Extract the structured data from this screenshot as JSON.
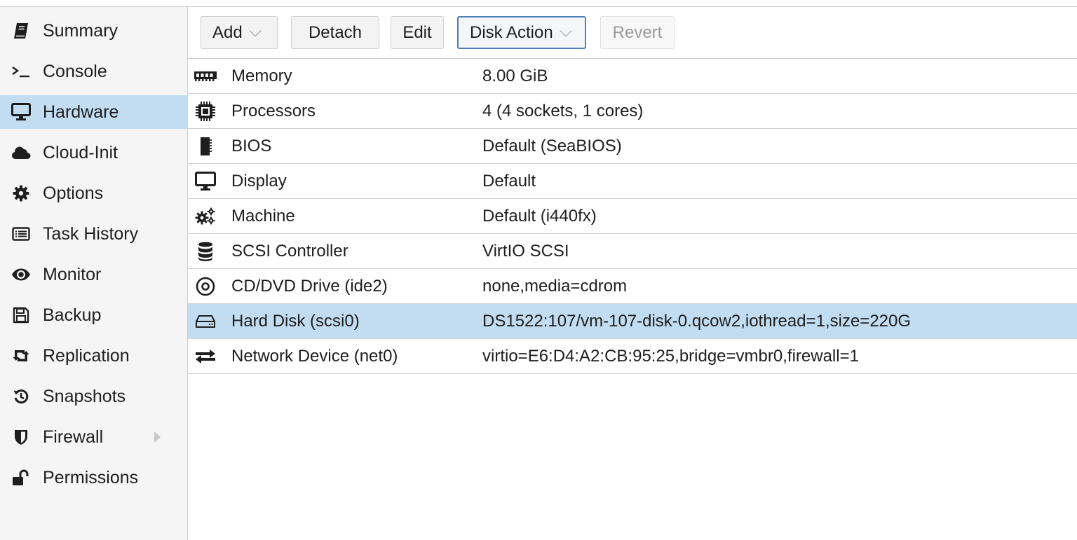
{
  "sidebar": {
    "items": [
      {
        "label": "Summary",
        "icon": "book-icon"
      },
      {
        "label": "Console",
        "icon": "terminal-icon"
      },
      {
        "label": "Hardware",
        "icon": "desktop-icon",
        "active": true
      },
      {
        "label": "Cloud-Init",
        "icon": "cloud-icon"
      },
      {
        "label": "Options",
        "icon": "gear-icon"
      },
      {
        "label": "Task History",
        "icon": "list-icon"
      },
      {
        "label": "Monitor",
        "icon": "eye-icon"
      },
      {
        "label": "Backup",
        "icon": "floppy-icon"
      },
      {
        "label": "Replication",
        "icon": "retweet-icon"
      },
      {
        "label": "Snapshots",
        "icon": "history-icon"
      },
      {
        "label": "Firewall",
        "icon": "shield-icon",
        "expandable": true
      },
      {
        "label": "Permissions",
        "icon": "unlock-icon"
      }
    ]
  },
  "toolbar": {
    "add_label": "Add",
    "detach_label": "Detach",
    "edit_label": "Edit",
    "disk_action_label": "Disk Action",
    "revert_label": "Revert"
  },
  "hardware": {
    "rows": [
      {
        "name": "Memory",
        "value": "8.00 GiB",
        "icon": "memory-icon"
      },
      {
        "name": "Processors",
        "value": "4 (4 sockets, 1 cores)",
        "icon": "cpu-icon"
      },
      {
        "name": "BIOS",
        "value": "Default (SeaBIOS)",
        "icon": "bios-chip-icon"
      },
      {
        "name": "Display",
        "value": "Default",
        "icon": "display-icon"
      },
      {
        "name": "Machine",
        "value": "Default (i440fx)",
        "icon": "cogs-icon"
      },
      {
        "name": "SCSI Controller",
        "value": "VirtIO SCSI",
        "icon": "database-icon"
      },
      {
        "name": "CD/DVD Drive (ide2)",
        "value": "none,media=cdrom",
        "icon": "cdrom-icon"
      },
      {
        "name": "Hard Disk (scsi0)",
        "value": "DS1522:107/vm-107-disk-0.qcow2,iothread=1,size=220G",
        "icon": "hdd-icon",
        "selected": true
      },
      {
        "name": "Network Device (net0)",
        "value": "virtio=E6:D4:A2:CB:95:25,bridge=vmbr0,firewall=1",
        "icon": "exchange-icon"
      }
    ]
  },
  "colors": {
    "selection": "#c2ddf2",
    "sidebar_bg": "#f5f5f5",
    "focus_border": "#4f7fb8"
  }
}
